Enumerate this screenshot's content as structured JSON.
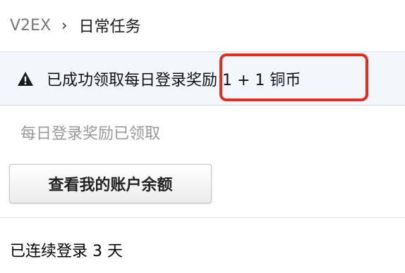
{
  "breadcrumb": {
    "root": "V2EX",
    "separator": "›",
    "current": "日常任务"
  },
  "alert": {
    "icon": "warning-icon",
    "message": "已成功领取每日登录奖励 1 + 1 铜币"
  },
  "daily": {
    "claimed_text": "每日登录奖励已领取",
    "balance_button_label": "查看我的账户余额",
    "streak_text": "已连续登录 3 天"
  },
  "colors": {
    "highlight_border": "#e02c21",
    "alert_background": "#f3f6fb"
  }
}
